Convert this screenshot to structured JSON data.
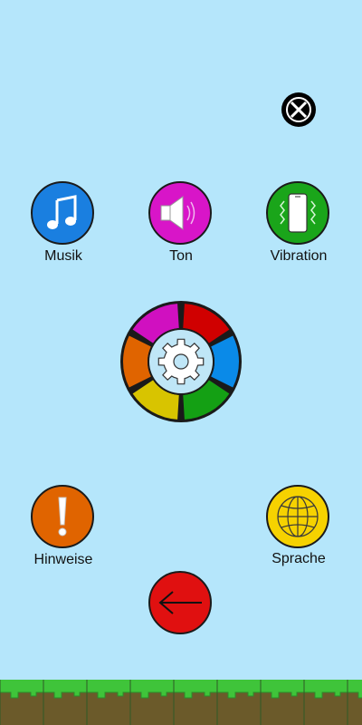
{
  "colors": {
    "background": "#b5e6fb",
    "music": "#1a7fe0",
    "sound": "#d815c8",
    "vibration": "#1aa51a",
    "hints": "#e06400",
    "language": "#f6d200",
    "back": "#e01010",
    "wheel": [
      "#d00000",
      "#0a8ae8",
      "#14a014",
      "#d8c400",
      "#e06400",
      "#d010c0"
    ],
    "gear": "#bfe6f7",
    "grass": "#3fc43a",
    "dirt": "#6b5a2a"
  },
  "buttons": {
    "music_label": "Musik",
    "sound_label": "Ton",
    "vibration_label": "Vibration",
    "hints_label": "Hinweise",
    "language_label": "Sprache"
  },
  "icons": {
    "close": "close-icon",
    "music": "music-note-icon",
    "sound": "speaker-icon",
    "vibration": "vibrating-phone-icon",
    "settings": "gear-icon",
    "hints": "exclamation-icon",
    "language": "globe-icon",
    "back": "arrow-left-icon"
  }
}
